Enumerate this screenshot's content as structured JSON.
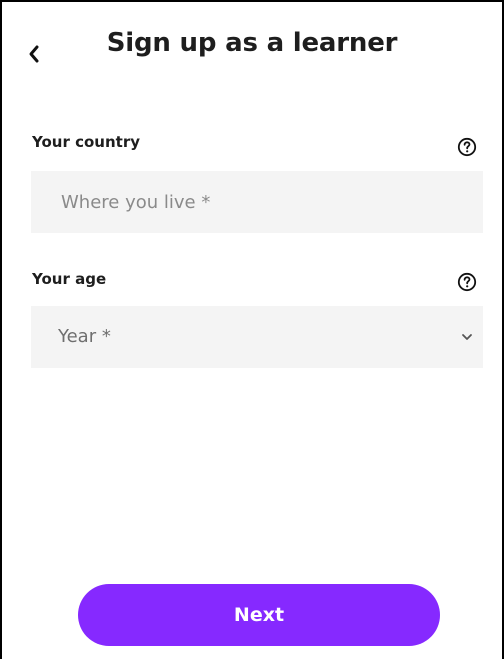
{
  "header": {
    "title": "Sign up as a learner",
    "back_icon": "chevron-left-icon"
  },
  "country": {
    "label": "Your country",
    "placeholder": "Where you live *",
    "help_icon": "help-circle-icon"
  },
  "age": {
    "label": "Your age",
    "selected_value": "Year *",
    "help_icon": "help-circle-icon",
    "dropdown_icon": "chevron-down-icon"
  },
  "footer": {
    "next_label": "Next"
  },
  "colors": {
    "accent": "#8629ff",
    "field_background": "#f4f4f4",
    "text": "#1e1e1e",
    "placeholder": "#8a8a8a"
  }
}
